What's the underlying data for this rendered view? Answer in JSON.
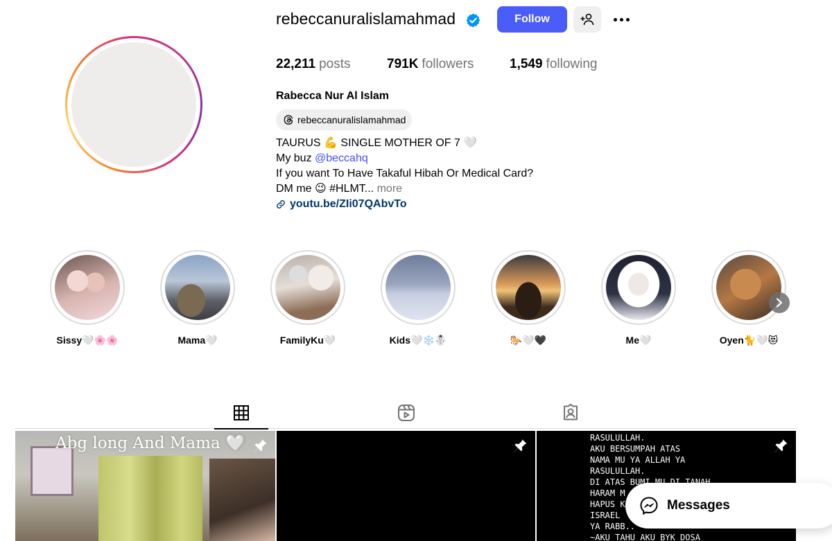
{
  "profile": {
    "username": "rebeccanuralislamahmad",
    "follow_label": "Follow",
    "stats": {
      "posts_count": "22,211",
      "posts_label": "posts",
      "followers_count": "791K",
      "followers_label": "followers",
      "following_count": "1,549",
      "following_label": "following"
    },
    "full_name": "Rabecca Nur Al Islam",
    "threads_handle": "rebeccanuralislamahmad",
    "bio": {
      "line1": "TAURUS 💪 SINGLE MOTHER OF 7 🤍",
      "line2_prefix": "My buz ",
      "line2_mention": "@beccahq",
      "line3": "If you want To Have Takaful Hibah Or Medical Card?",
      "line4": "DM me 😉 #HLMT...",
      "more_label": "more",
      "link": "youtu.be/ZIi07QAbvTo"
    },
    "accent_color": "#4a5df9"
  },
  "highlights": [
    {
      "label": "Sissy🤍🌸🌸"
    },
    {
      "label": "Mama🤍"
    },
    {
      "label": "FamilyKu🤍"
    },
    {
      "label": "Kids🤍❄️☃️"
    },
    {
      "label": "🐎🤍🖤"
    },
    {
      "label": "Me🤍"
    },
    {
      "label": "Oyen🐈🤍😻"
    }
  ],
  "tabs": [
    {
      "icon": "grid-icon",
      "active": true
    },
    {
      "icon": "reels-icon",
      "active": false
    },
    {
      "icon": "tagged-icon",
      "active": false
    }
  ],
  "posts": [
    {
      "caption": "Abg long And Mama 🤍",
      "pinned": true
    },
    {
      "caption": "",
      "pinned": true
    },
    {
      "lines": [
        "RASULULLAH.",
        "AKU BERSUMPAH ATAS",
        "NAMA MU YA ALLAH YA",
        "RASULULLAH.",
        "DI ATAS BUMI MU DI TANAH",
        "HARAM M",
        "HAPUS K",
        "ISRAEL",
        "YA RABB..",
        "~AKU TAHU AKU BYK DOSA"
      ],
      "pinned": true
    }
  ],
  "messages_label": "Messages"
}
